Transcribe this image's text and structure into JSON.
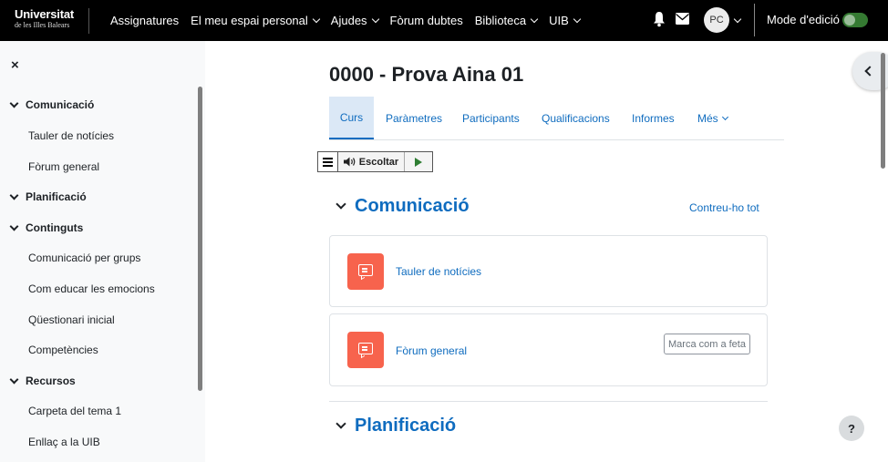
{
  "brand": {
    "line1": "Universitat",
    "line2": "de les Illes Balears"
  },
  "navbar": {
    "items": [
      {
        "label": "Assignatures",
        "dropdown": false
      },
      {
        "label": "El meu espai personal",
        "dropdown": true
      },
      {
        "label": "Ajudes",
        "dropdown": true
      },
      {
        "label": "Fòrum dubtes",
        "dropdown": false
      },
      {
        "label": "Biblioteca",
        "dropdown": true
      },
      {
        "label": "UIB",
        "dropdown": true
      }
    ],
    "avatar_initials": "PC",
    "edit_mode_label": "Mode d'edició",
    "edit_mode_on": false,
    "icons": [
      "bell-icon",
      "mail-icon"
    ]
  },
  "drawer": {
    "close_icon": "×",
    "sections": [
      {
        "title": "Comunicació",
        "items": [
          "Tauler de notícies",
          "Fòrum general"
        ]
      },
      {
        "title": "Planificació",
        "items": []
      },
      {
        "title": "Continguts",
        "items": [
          "Comunicació per grups",
          "Com educar les emocions",
          "Qüestionari inicial",
          "Competències"
        ]
      },
      {
        "title": "Recursos",
        "items": [
          "Carpeta del tema 1",
          "Enllaç a la UIB"
        ]
      }
    ]
  },
  "main": {
    "title": "0000 - Prova Aina 01",
    "tabs": [
      {
        "label": "Curs",
        "active": true
      },
      {
        "label": "Paràmetres",
        "active": false
      },
      {
        "label": "Participants",
        "active": false
      },
      {
        "label": "Qualificacions",
        "active": false
      },
      {
        "label": "Informes",
        "active": false
      },
      {
        "label": "Més",
        "active": false,
        "dropdown": true
      }
    ],
    "listen_label": "Escoltar",
    "collapse_all": "Contreu-ho tot",
    "sections": [
      {
        "title": "Comunicació",
        "activities": [
          {
            "name": "Tauler de notícies",
            "type": "forum"
          },
          {
            "name": "Fòrum general",
            "type": "forum",
            "completion_button": "Marca com a feta"
          }
        ]
      },
      {
        "title": "Planificació",
        "activities": []
      }
    ]
  },
  "help_label": "?",
  "colors": {
    "accent": "#0f6cbf",
    "forum_icon": "#f7634d",
    "toggle": "#357a32",
    "navbar": "#000000"
  }
}
